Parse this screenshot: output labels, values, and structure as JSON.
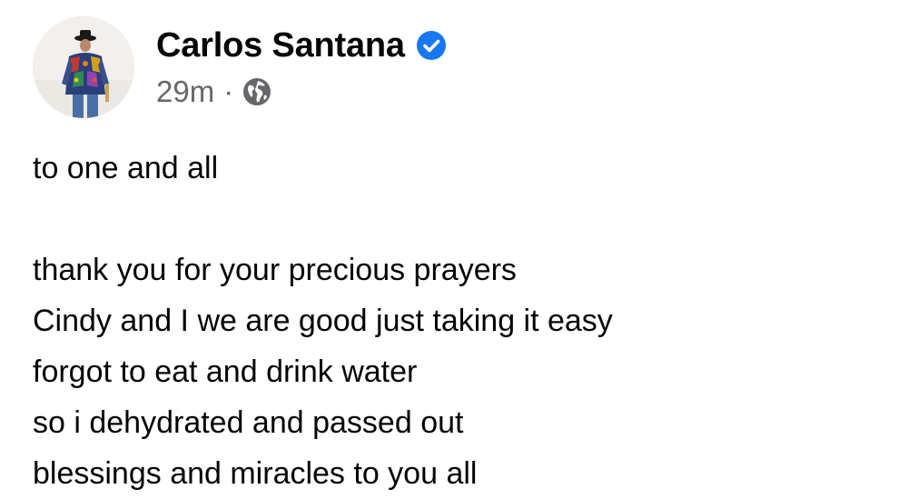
{
  "post": {
    "author": "Carlos Santana",
    "timestamp": "29m",
    "separator": "·",
    "icons": {
      "verified": "verified-badge-icon",
      "audience": "globe-icon"
    },
    "colors": {
      "verified": "#1877f2",
      "secondary_text": "#65676b"
    },
    "greeting": "to one and all",
    "lines": [
      "thank you for your precious prayers",
      "Cindy and I we are good just taking it easy",
      "forgot to eat and drink water",
      "so i dehydrated and passed out",
      "blessings and miracles to you all"
    ]
  }
}
